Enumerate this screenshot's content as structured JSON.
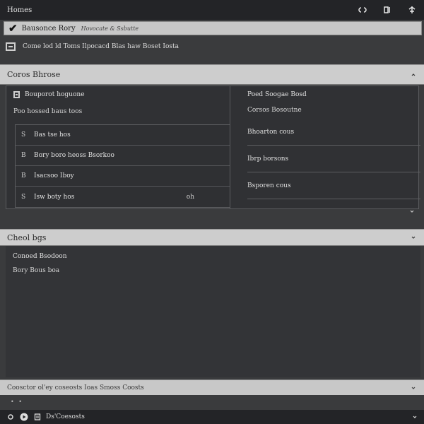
{
  "window": {
    "title": "Homes",
    "icons": [
      "link-icon",
      "book-icon",
      "pin-icon"
    ]
  },
  "notice": {
    "title": "Bausonce Rory",
    "subtitle": "Hovocate & Ssbutte"
  },
  "infobar": {
    "text": "Come lod ld Toms Ilpocacd Blas haw Boset Iosta"
  },
  "section1": {
    "title": "Coros Bhrose",
    "left": {
      "heading": "Bouporot hoguone",
      "subheading": "Poo hossed baus toos",
      "items": [
        {
          "glyph": "S",
          "label": "Bas tse hos",
          "trail": ""
        },
        {
          "glyph": "B",
          "label": "Bory boro heoss Bsorkoo",
          "trail": ""
        },
        {
          "glyph": "B",
          "label": "Isacsoo Iboy",
          "trail": ""
        },
        {
          "glyph": "S",
          "label": "Isw boty hos",
          "trail": "oh"
        }
      ]
    },
    "right": {
      "heading": "Poed Soogae Bosd",
      "subheading": "Corsos Bosoutne",
      "rows": [
        "Bhoarton cous",
        "Ibrp borsons",
        "Bsporen cous"
      ]
    }
  },
  "section2": {
    "title": "Cheol bgs",
    "line1": "Conoed Bsodoon",
    "line2": "Bory Bous boa"
  },
  "footer": {
    "text": "Coosctor ol'ey coseosts Ioas Smoss Coosts"
  },
  "dots": "• •",
  "statusbar": {
    "label": "Ds'Coesosts",
    "icons": [
      "gear-icon",
      "play-icon",
      "doc-icon"
    ]
  }
}
